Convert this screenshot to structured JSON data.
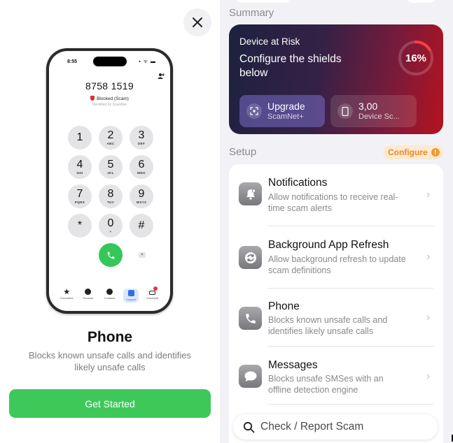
{
  "onboarding": {
    "close_icon": "close-icon",
    "phone_mock": {
      "time": "8:55",
      "status_icons": "▪ ᯤ ▬",
      "number": "8758 1519",
      "blocked_label": "Blocked (Scam)",
      "identified_by": "Identified by ScamNet",
      "keys": [
        {
          "digit": "1",
          "letters": ""
        },
        {
          "digit": "2",
          "letters": "ABC"
        },
        {
          "digit": "3",
          "letters": "DEF"
        },
        {
          "digit": "4",
          "letters": "GHI"
        },
        {
          "digit": "5",
          "letters": "JKL"
        },
        {
          "digit": "6",
          "letters": "MNO"
        },
        {
          "digit": "7",
          "letters": "PQRS"
        },
        {
          "digit": "8",
          "letters": "TUV"
        },
        {
          "digit": "9",
          "letters": "WXYZ"
        },
        {
          "digit": "*",
          "letters": ""
        },
        {
          "digit": "0",
          "letters": "+"
        },
        {
          "digit": "#",
          "letters": ""
        }
      ],
      "tabs": [
        "Favourites",
        "Recents",
        "Contacts",
        "Keypad",
        "Voicemail"
      ]
    },
    "title": "Phone",
    "description": "Blocks known unsafe calls and identifies likely unsafe calls",
    "cta_label": "Get Started",
    "cta_color": "#3fc85a"
  },
  "dashboard": {
    "summary_header": "Summary",
    "risk_card": {
      "status": "Device at Risk",
      "message": "Configure the shields below",
      "percent_label": "16%",
      "percent_value": 16,
      "upgrade": {
        "title": "Upgrade",
        "subtitle": "ScamNet+"
      },
      "device": {
        "title": "3,00",
        "subtitle": "Device Sc..."
      }
    },
    "setup_header": "Setup",
    "configure_label": "Configure",
    "configure_badge": "!",
    "setup_items": [
      {
        "icon": "bell-icon",
        "title": "Notifications",
        "subtitle": "Allow notifications to receive real-time scam alerts"
      },
      {
        "icon": "refresh-icon",
        "title": "Background App Refresh",
        "subtitle": "Allow background refresh to update scam definitions"
      },
      {
        "icon": "phone-icon",
        "title": "Phone",
        "subtitle": "Blocks known unsafe calls and identifies likely unsafe calls"
      },
      {
        "icon": "message-icon",
        "title": "Messages",
        "subtitle": "Blocks unsafe SMSes with an offline detection engine"
      }
    ],
    "search_placeholder": "Check / Report Scam"
  }
}
